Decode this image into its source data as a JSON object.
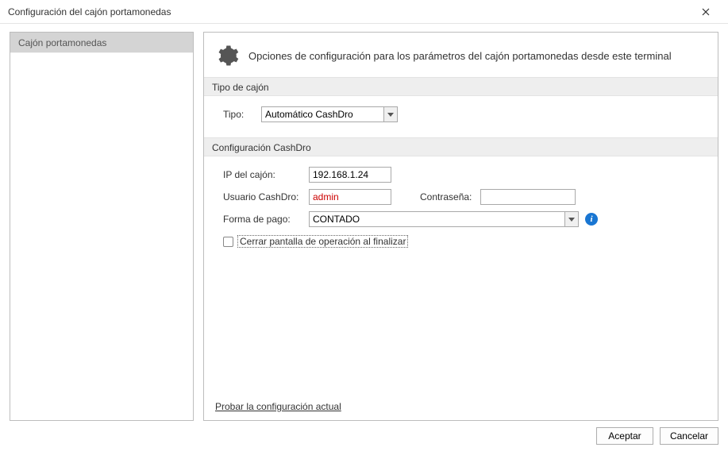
{
  "window": {
    "title": "Configuración del cajón portamonedas"
  },
  "sidebar": {
    "items": [
      {
        "label": "Cajón portamonedas"
      }
    ]
  },
  "main": {
    "header": "Opciones de configuración para los parámetros del cajón portamonedas desde este terminal",
    "section_tipo": {
      "title": "Tipo de cajón",
      "tipo_label": "Tipo:",
      "tipo_value": "Automático CashDro"
    },
    "section_cashdro": {
      "title": "Configuración CashDro",
      "ip_label": "IP del cajón:",
      "ip_value": "192.168.1.24",
      "user_label": "Usuario CashDro:",
      "user_value": "admin",
      "pass_label": "Contraseña:",
      "pass_value": "",
      "forma_label": "Forma de pago:",
      "forma_value": "CONTADO",
      "checkbox_label": "Cerrar pantalla de operación al finalizar"
    },
    "test_link": "Probar la configuración actual"
  },
  "footer": {
    "accept": "Aceptar",
    "cancel": "Cancelar"
  },
  "info_glyph": "i"
}
